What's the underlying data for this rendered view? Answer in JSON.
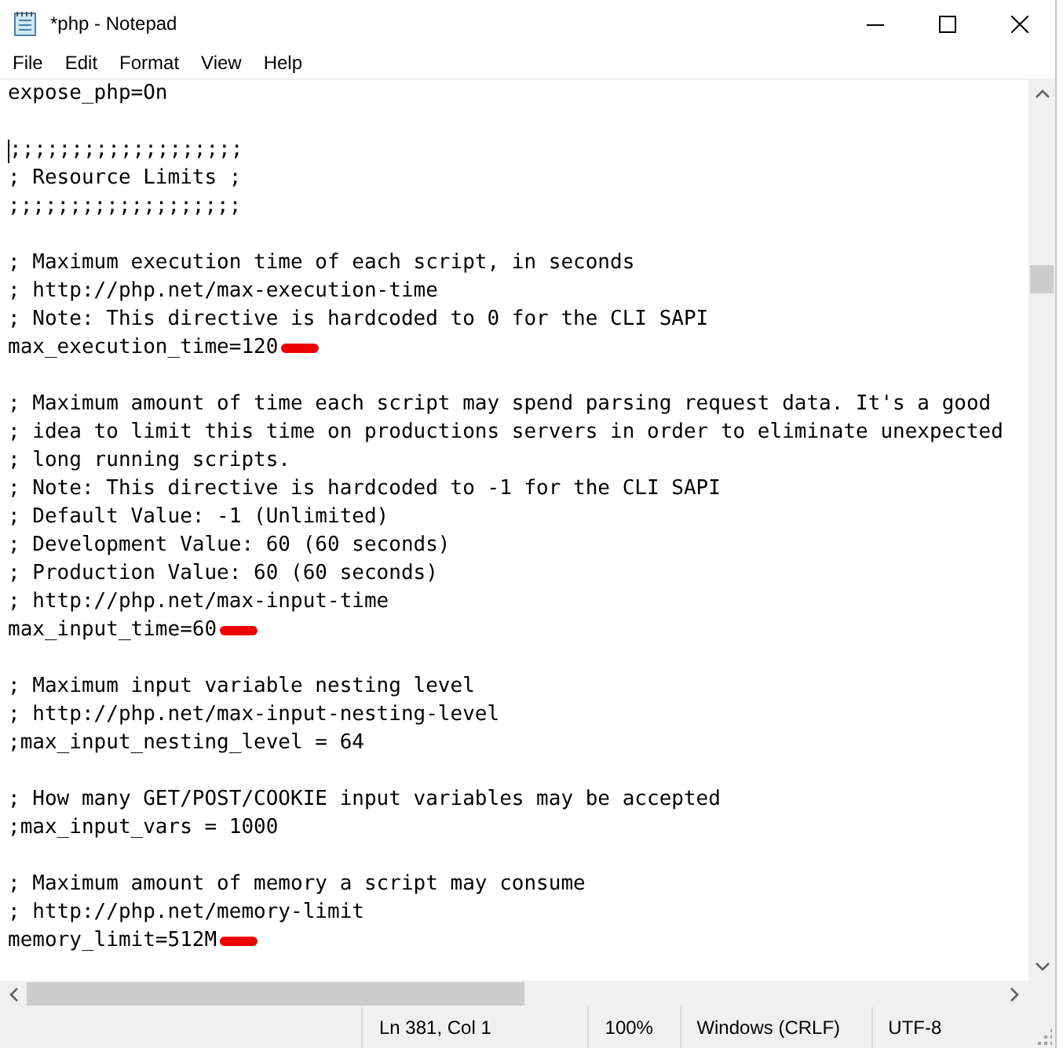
{
  "window": {
    "title": "*php - Notepad"
  },
  "menu": [
    "File",
    "Edit",
    "Format",
    "View",
    "Help"
  ],
  "lines": [
    {
      "kind": "text",
      "text": "expose_php=On"
    },
    {
      "kind": "blank"
    },
    {
      "kind": "text",
      "text": ";;;;;;;;;;;;;;;;;;;",
      "cursor": true
    },
    {
      "kind": "text",
      "text": "; Resource Limits ;"
    },
    {
      "kind": "text",
      "text": ";;;;;;;;;;;;;;;;;;;"
    },
    {
      "kind": "blank"
    },
    {
      "kind": "text",
      "text": "; Maximum execution time of each script, in seconds"
    },
    {
      "kind": "text",
      "text": "; http://php.net/max-execution-time"
    },
    {
      "kind": "text",
      "text": "; Note: This directive is hardcoded to 0 for the CLI SAPI"
    },
    {
      "kind": "text",
      "text": "max_execution_time=120",
      "marked": true
    },
    {
      "kind": "blank"
    },
    {
      "kind": "text",
      "text": "; Maximum amount of time each script may spend parsing request data. It's a good"
    },
    {
      "kind": "text",
      "text": "; idea to limit this time on productions servers in order to eliminate unexpected"
    },
    {
      "kind": "text",
      "text": "; long running scripts."
    },
    {
      "kind": "text",
      "text": "; Note: This directive is hardcoded to -1 for the CLI SAPI"
    },
    {
      "kind": "text",
      "text": "; Default Value: -1 (Unlimited)"
    },
    {
      "kind": "text",
      "text": "; Development Value: 60 (60 seconds)"
    },
    {
      "kind": "text",
      "text": "; Production Value: 60 (60 seconds)"
    },
    {
      "kind": "text",
      "text": "; http://php.net/max-input-time"
    },
    {
      "kind": "text",
      "text": "max_input_time=60",
      "marked": true
    },
    {
      "kind": "blank"
    },
    {
      "kind": "text",
      "text": "; Maximum input variable nesting level"
    },
    {
      "kind": "text",
      "text": "; http://php.net/max-input-nesting-level"
    },
    {
      "kind": "text",
      "text": ";max_input_nesting_level = 64"
    },
    {
      "kind": "blank"
    },
    {
      "kind": "text",
      "text": "; How many GET/POST/COOKIE input variables may be accepted"
    },
    {
      "kind": "text",
      "text": ";max_input_vars = 1000"
    },
    {
      "kind": "blank"
    },
    {
      "kind": "text",
      "text": "; Maximum amount of memory a script may consume"
    },
    {
      "kind": "text",
      "text": "; http://php.net/memory-limit"
    },
    {
      "kind": "text",
      "text": "memory_limit=512M",
      "marked": true
    }
  ],
  "status_bar": {
    "position": "Ln 381, Col 1",
    "zoom": "100%",
    "line_endings": "Windows (CRLF)",
    "encoding": "UTF-8"
  }
}
